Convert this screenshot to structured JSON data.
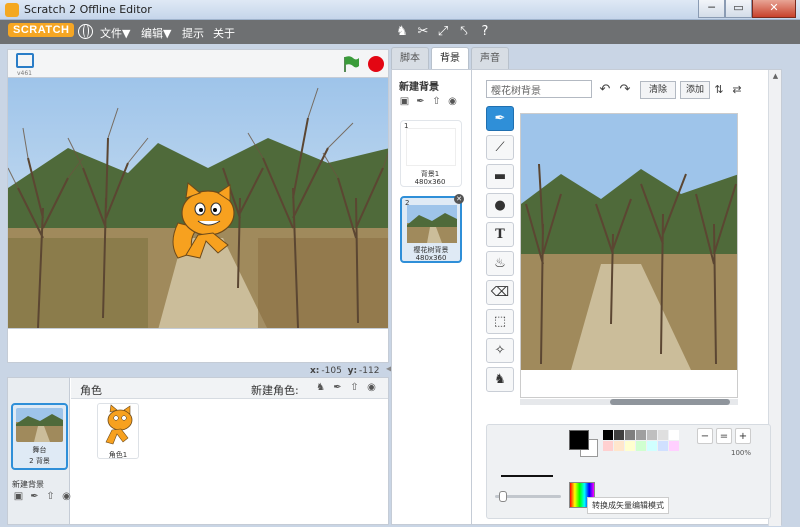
{
  "window": {
    "title": "Scratch 2 Offline Editor",
    "minimize": "─",
    "maximize": "▭",
    "close": "✕"
  },
  "menu": {
    "logo": "SCRATCH",
    "file": "文件▼",
    "edit": "编辑▼",
    "tips": "提示",
    "about": "关于"
  },
  "stage": {
    "version": "v461",
    "coords": {
      "x_label": "x:",
      "x": "-105",
      "y_label": "y:",
      "y": "-112"
    }
  },
  "sprites": {
    "title": "角色",
    "new_sprite_label": "新建角色:",
    "stage_thumb": {
      "name": "舞台",
      "count": "2 背景"
    },
    "new_bg_label": "新建背景",
    "items": [
      {
        "name": "角色1"
      }
    ]
  },
  "tabs": [
    {
      "label": "脚本"
    },
    {
      "label": "背景"
    },
    {
      "label": "声音"
    }
  ],
  "backdrops": {
    "title": "新建背景",
    "items": [
      {
        "num": "1",
        "name": "背景1",
        "size": "480x360"
      },
      {
        "num": "2",
        "name": "樱花树背景",
        "size": "480x360"
      }
    ]
  },
  "paint": {
    "name_value": "樱花树背景",
    "clear_label": "清除",
    "add_label": "添加",
    "zoom_level": "100%",
    "mode_label": "转换成矢量编辑模式"
  },
  "colors": {
    "accent": "#2f8fd8",
    "stop": "#e30613",
    "palette": [
      "#000000",
      "#3f3f3f",
      "#7f7f7f",
      "#9f9f9f",
      "#bfbfbf",
      "#dfdfdf",
      "#ffffff",
      "#ffd0d0",
      "#ffe6cc",
      "#ffffd0",
      "#d0ffd0",
      "#d0ffff",
      "#d0e0ff",
      "#ffd0ff"
    ]
  }
}
